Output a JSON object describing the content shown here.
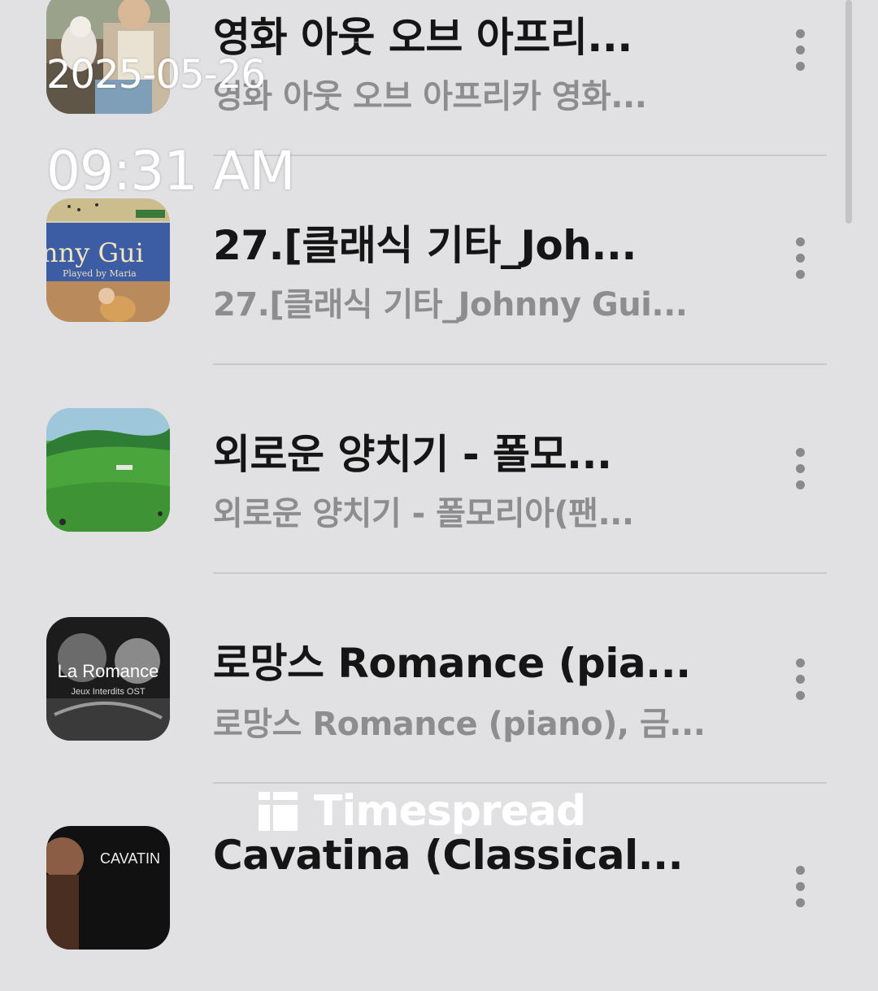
{
  "overlay": {
    "date": "2025-05-26",
    "time": "09:31 AM",
    "watermark": "Timespread"
  },
  "playlist": {
    "items": [
      {
        "title": "영화 아웃 오브 아프리...",
        "subtitle": "영화 아웃 오브 아프리카 영화...",
        "thumb_icon": "movie-still-thumbnail"
      },
      {
        "title": "27.[클래식 기타_Joh...",
        "subtitle": "27.[클래식 기타_Johnny Gui...",
        "thumb_icon": "guitar-video-thumbnail",
        "thumb_text": "nny Gui",
        "thumb_subtext": "Played by Maria"
      },
      {
        "title": "외로운 양치기 - 폴모...",
        "subtitle": "외로운 양치기 - 폴모리아(팬...",
        "thumb_icon": "green-pasture-thumbnail"
      },
      {
        "title": "로망스 Romance (pia...",
        "subtitle": "로망스 Romance (piano), 금...",
        "thumb_icon": "la-romance-thumbnail",
        "thumb_text": "La Romance",
        "thumb_subtext": "Jeux Interdits OST"
      },
      {
        "title": "Cavatina (Classical...",
        "subtitle": "",
        "thumb_icon": "cavatina-thumbnail",
        "thumb_text": "CAVATIN"
      }
    ]
  },
  "colors": {
    "background": "#e1e1e3",
    "title": "#151515",
    "subtitle": "#8d8d8f",
    "divider": "#c9c9cc"
  }
}
